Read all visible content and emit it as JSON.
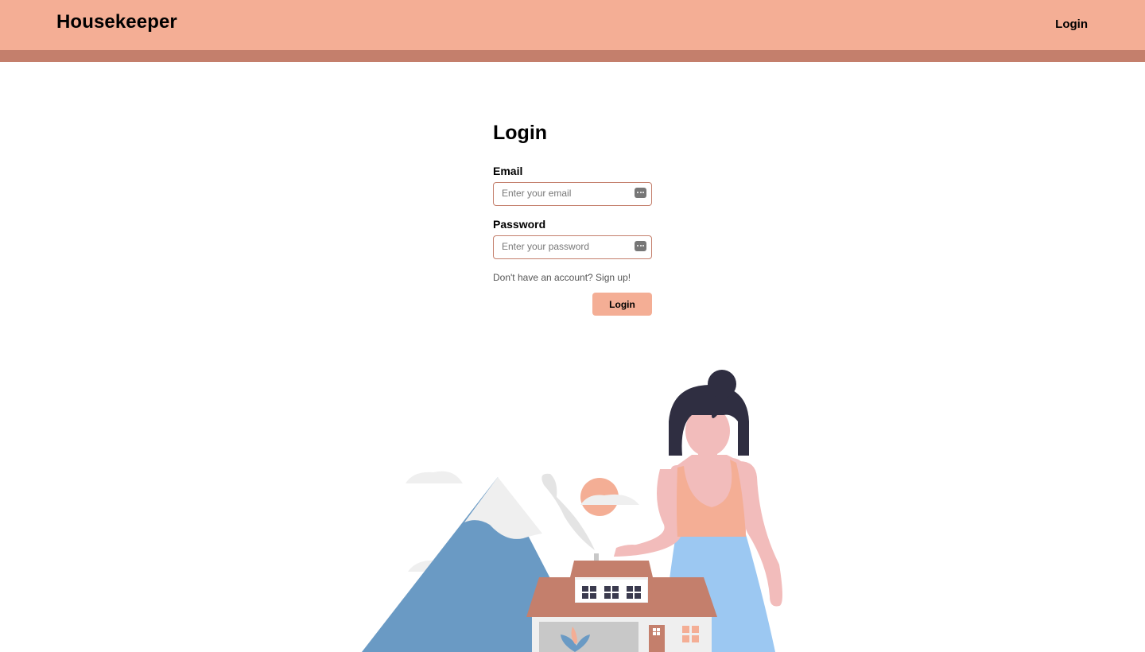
{
  "navbar": {
    "brand": "Housekeeper",
    "login_link": "Login"
  },
  "form": {
    "title": "Login",
    "email": {
      "label": "Email",
      "placeholder": "Enter your email",
      "value": ""
    },
    "password": {
      "label": "Password",
      "placeholder": "Enter your password",
      "value": ""
    },
    "signup_prompt": "Don't have an account? Sign up!",
    "submit_label": "Login"
  },
  "colors": {
    "accent": "#f4ae95",
    "accent_dark": "#c47f6c",
    "input_border": "#c47f6c",
    "mountain_blue": "#6a9ac4",
    "skirt_blue": "#9cc8f2",
    "hair": "#2f2e41"
  },
  "icons": {
    "password_manager": "key-dots-icon"
  },
  "illustration": {
    "semantic": "woman-house-mountain-illustration"
  }
}
